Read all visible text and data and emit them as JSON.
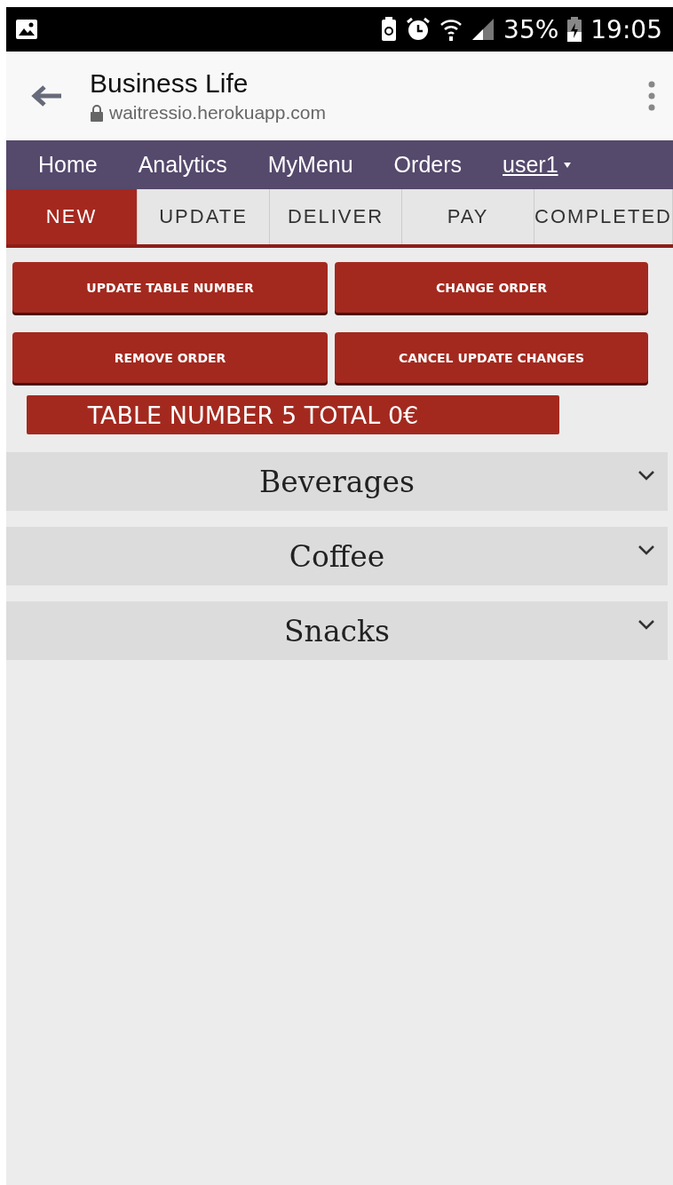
{
  "status_bar": {
    "battery": "35%",
    "time": "19:05"
  },
  "browser": {
    "title": "Business Life",
    "url": "waitressio.herokuapp.com"
  },
  "nav": {
    "items": [
      "Home",
      "Analytics",
      "MyMenu",
      "Orders"
    ],
    "user": "user1"
  },
  "tabs": [
    {
      "label": "NEW",
      "selected": true
    },
    {
      "label": "UPDATE",
      "selected": false
    },
    {
      "label": "DELIVER",
      "selected": false
    },
    {
      "label": "PAY",
      "selected": false
    },
    {
      "label": "COMPLETED",
      "selected": false
    }
  ],
  "buttons": [
    "UPDATE TABLE NUMBER",
    "CHANGE ORDER",
    "REMOVE ORDER",
    "CANCEL UPDATE CHANGES"
  ],
  "summary": "TABLE NUMBER 5 TOTAL 0€",
  "categories": [
    {
      "name": "Beverages",
      "expanded": false
    },
    {
      "name": "Coffee",
      "expanded": false
    },
    {
      "name": "Snacks",
      "expanded": false
    }
  ]
}
